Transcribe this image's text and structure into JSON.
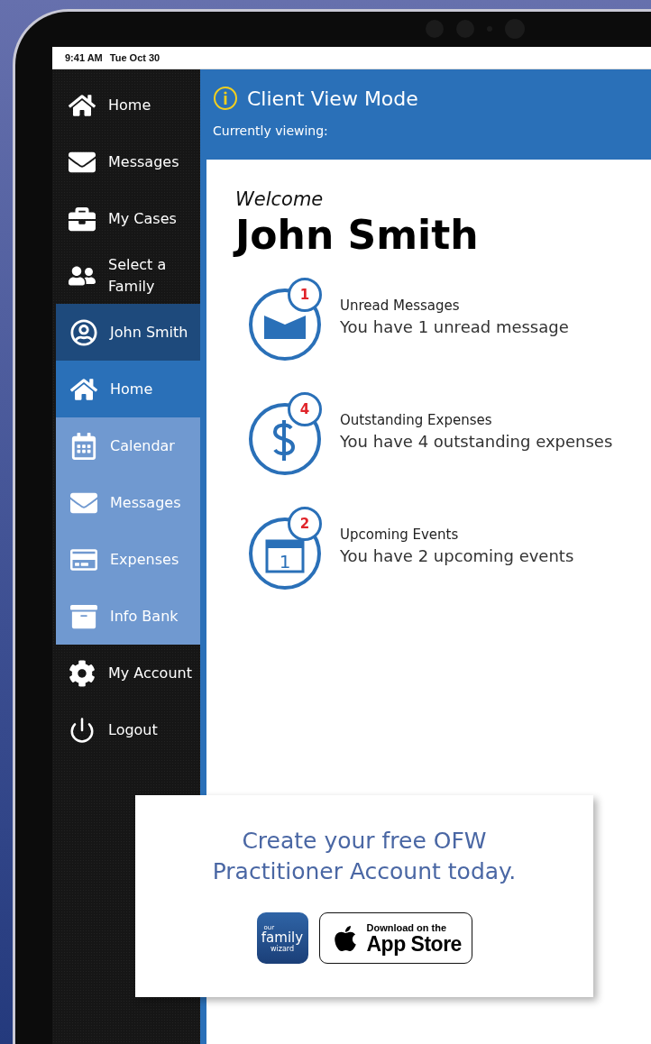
{
  "status_bar": {
    "time": "9:41 AM",
    "date": "Tue Oct 30"
  },
  "sidebar": {
    "items": [
      {
        "label": "Home",
        "kind": "main",
        "selected": false
      },
      {
        "label": "Messages",
        "kind": "main",
        "selected": false
      },
      {
        "label": "My Cases",
        "kind": "main",
        "selected": false
      },
      {
        "label": "Select a Family",
        "kind": "main",
        "selected": false
      },
      {
        "label": "John Smith",
        "kind": "client",
        "selected": false
      },
      {
        "label": "Home",
        "kind": "client_sub",
        "selected": true
      },
      {
        "label": "Calendar",
        "kind": "client_sub",
        "selected": false
      },
      {
        "label": "Messages",
        "kind": "client_sub",
        "selected": false
      },
      {
        "label": "Expenses",
        "kind": "client_sub",
        "selected": false
      },
      {
        "label": "Info Bank",
        "kind": "client_sub",
        "selected": false
      },
      {
        "label": "My Account",
        "kind": "main",
        "selected": false
      },
      {
        "label": "Logout",
        "kind": "main",
        "selected": false
      }
    ]
  },
  "header": {
    "title": "Client View Mode",
    "subtitle": "Currently viewing:"
  },
  "welcome": {
    "greeting": "Welcome",
    "name": "John Smith"
  },
  "summaries": [
    {
      "kind": "messages",
      "badge": "1",
      "title": "Unread Messages",
      "text": "You have 1 unread message"
    },
    {
      "kind": "expenses",
      "badge": "4",
      "title": "Outstanding Expenses",
      "text": "You have 4 outstanding expenses"
    },
    {
      "kind": "events",
      "badge": "2",
      "title": "Upcoming Events",
      "text": "You have 2 upcoming events",
      "day": "1"
    }
  ],
  "promo": {
    "headline": [
      "Create your free OFW",
      "Practitioner Account today."
    ],
    "app_icon": {
      "top": "our",
      "middle": "family",
      "bottom": "wizard"
    },
    "store_badge": {
      "small": "Download on the",
      "large": "App Store"
    }
  }
}
